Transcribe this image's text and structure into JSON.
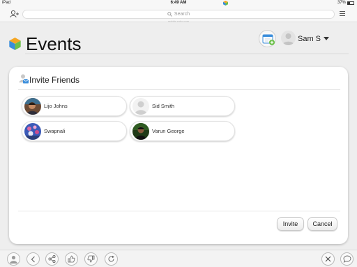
{
  "status_bar": {
    "device": "iPad",
    "time": "6:49 AM",
    "battery": "37%"
  },
  "browser": {
    "search_placeholder": "Search",
    "url": "mobile.zoho.com"
  },
  "header": {
    "title": "Events",
    "user_name": "Sam S"
  },
  "card": {
    "title": "Invite Friends",
    "friends": [
      {
        "name": "Lijo Johns"
      },
      {
        "name": "Sid Smith"
      },
      {
        "name": "Swapnali"
      },
      {
        "name": "Varun George"
      }
    ],
    "invite_label": "Invite",
    "cancel_label": "Cancel"
  },
  "colors": {
    "accent_blue": "#3a8ddb",
    "cube_green": "#6cc04a",
    "cube_orange": "#f5a623"
  },
  "toolbar_icons": [
    "profile-icon",
    "back-icon",
    "share-icon",
    "like-icon",
    "dislike-icon",
    "refresh-icon",
    "close-icon",
    "comment-icon"
  ]
}
